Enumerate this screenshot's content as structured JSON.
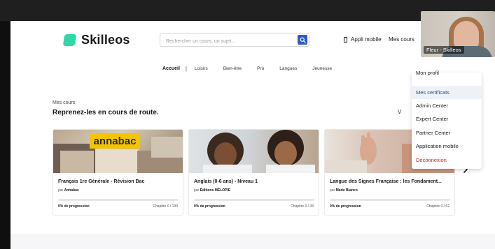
{
  "header": {
    "logo_text": "Skilleos",
    "search_placeholder": "Rechercher un cours, un sujet...",
    "appli_mobile": "Appli mobile",
    "mes_cours": "Mes cours"
  },
  "nav": {
    "items": [
      "Accueil",
      "Loisirs",
      "Bien-être",
      "Pro",
      "Langues",
      "Jeunesse"
    ],
    "separator": "|"
  },
  "section": {
    "kicker": "Mes cours",
    "title": "Reprenez-les en cours de route.",
    "voir_partial": "V"
  },
  "courses": [
    {
      "image_text": "annabac",
      "title": "Français 1re Générale - Révision Bac",
      "by_prefix": "par",
      "author": "Annabac",
      "progress_label": "0% de progression",
      "chapter": "Chapitre 0 / 130",
      "progress": 0
    },
    {
      "title": "Anglais (0-6 ans) - Niveau 1",
      "by_prefix": "par",
      "author": "Éditions MÉLOPIE",
      "progress_label": "0% de progression",
      "chapter": "Chapitre 0 / 33",
      "progress": 0
    },
    {
      "title": "Langue des Signes Française : les Fondament...",
      "by_prefix": "par",
      "author": "Marie Bianco",
      "progress_label": "0% de progression",
      "chapter": "Chapitre 0 / 62",
      "progress": 0
    }
  ],
  "dropdown": {
    "items": [
      "Mon profil",
      "Mes certificats",
      "Admin Center",
      "Expert Center",
      "Partner Center",
      "Application mobile",
      "Déconnexion"
    ]
  },
  "video": {
    "label": "Fleur - Skilleos"
  },
  "colors": {
    "brand": "#2fd9a6",
    "search_button": "#2f5cc4",
    "annabac_yellow": "#f2c500",
    "logout_red": "#c62828"
  }
}
